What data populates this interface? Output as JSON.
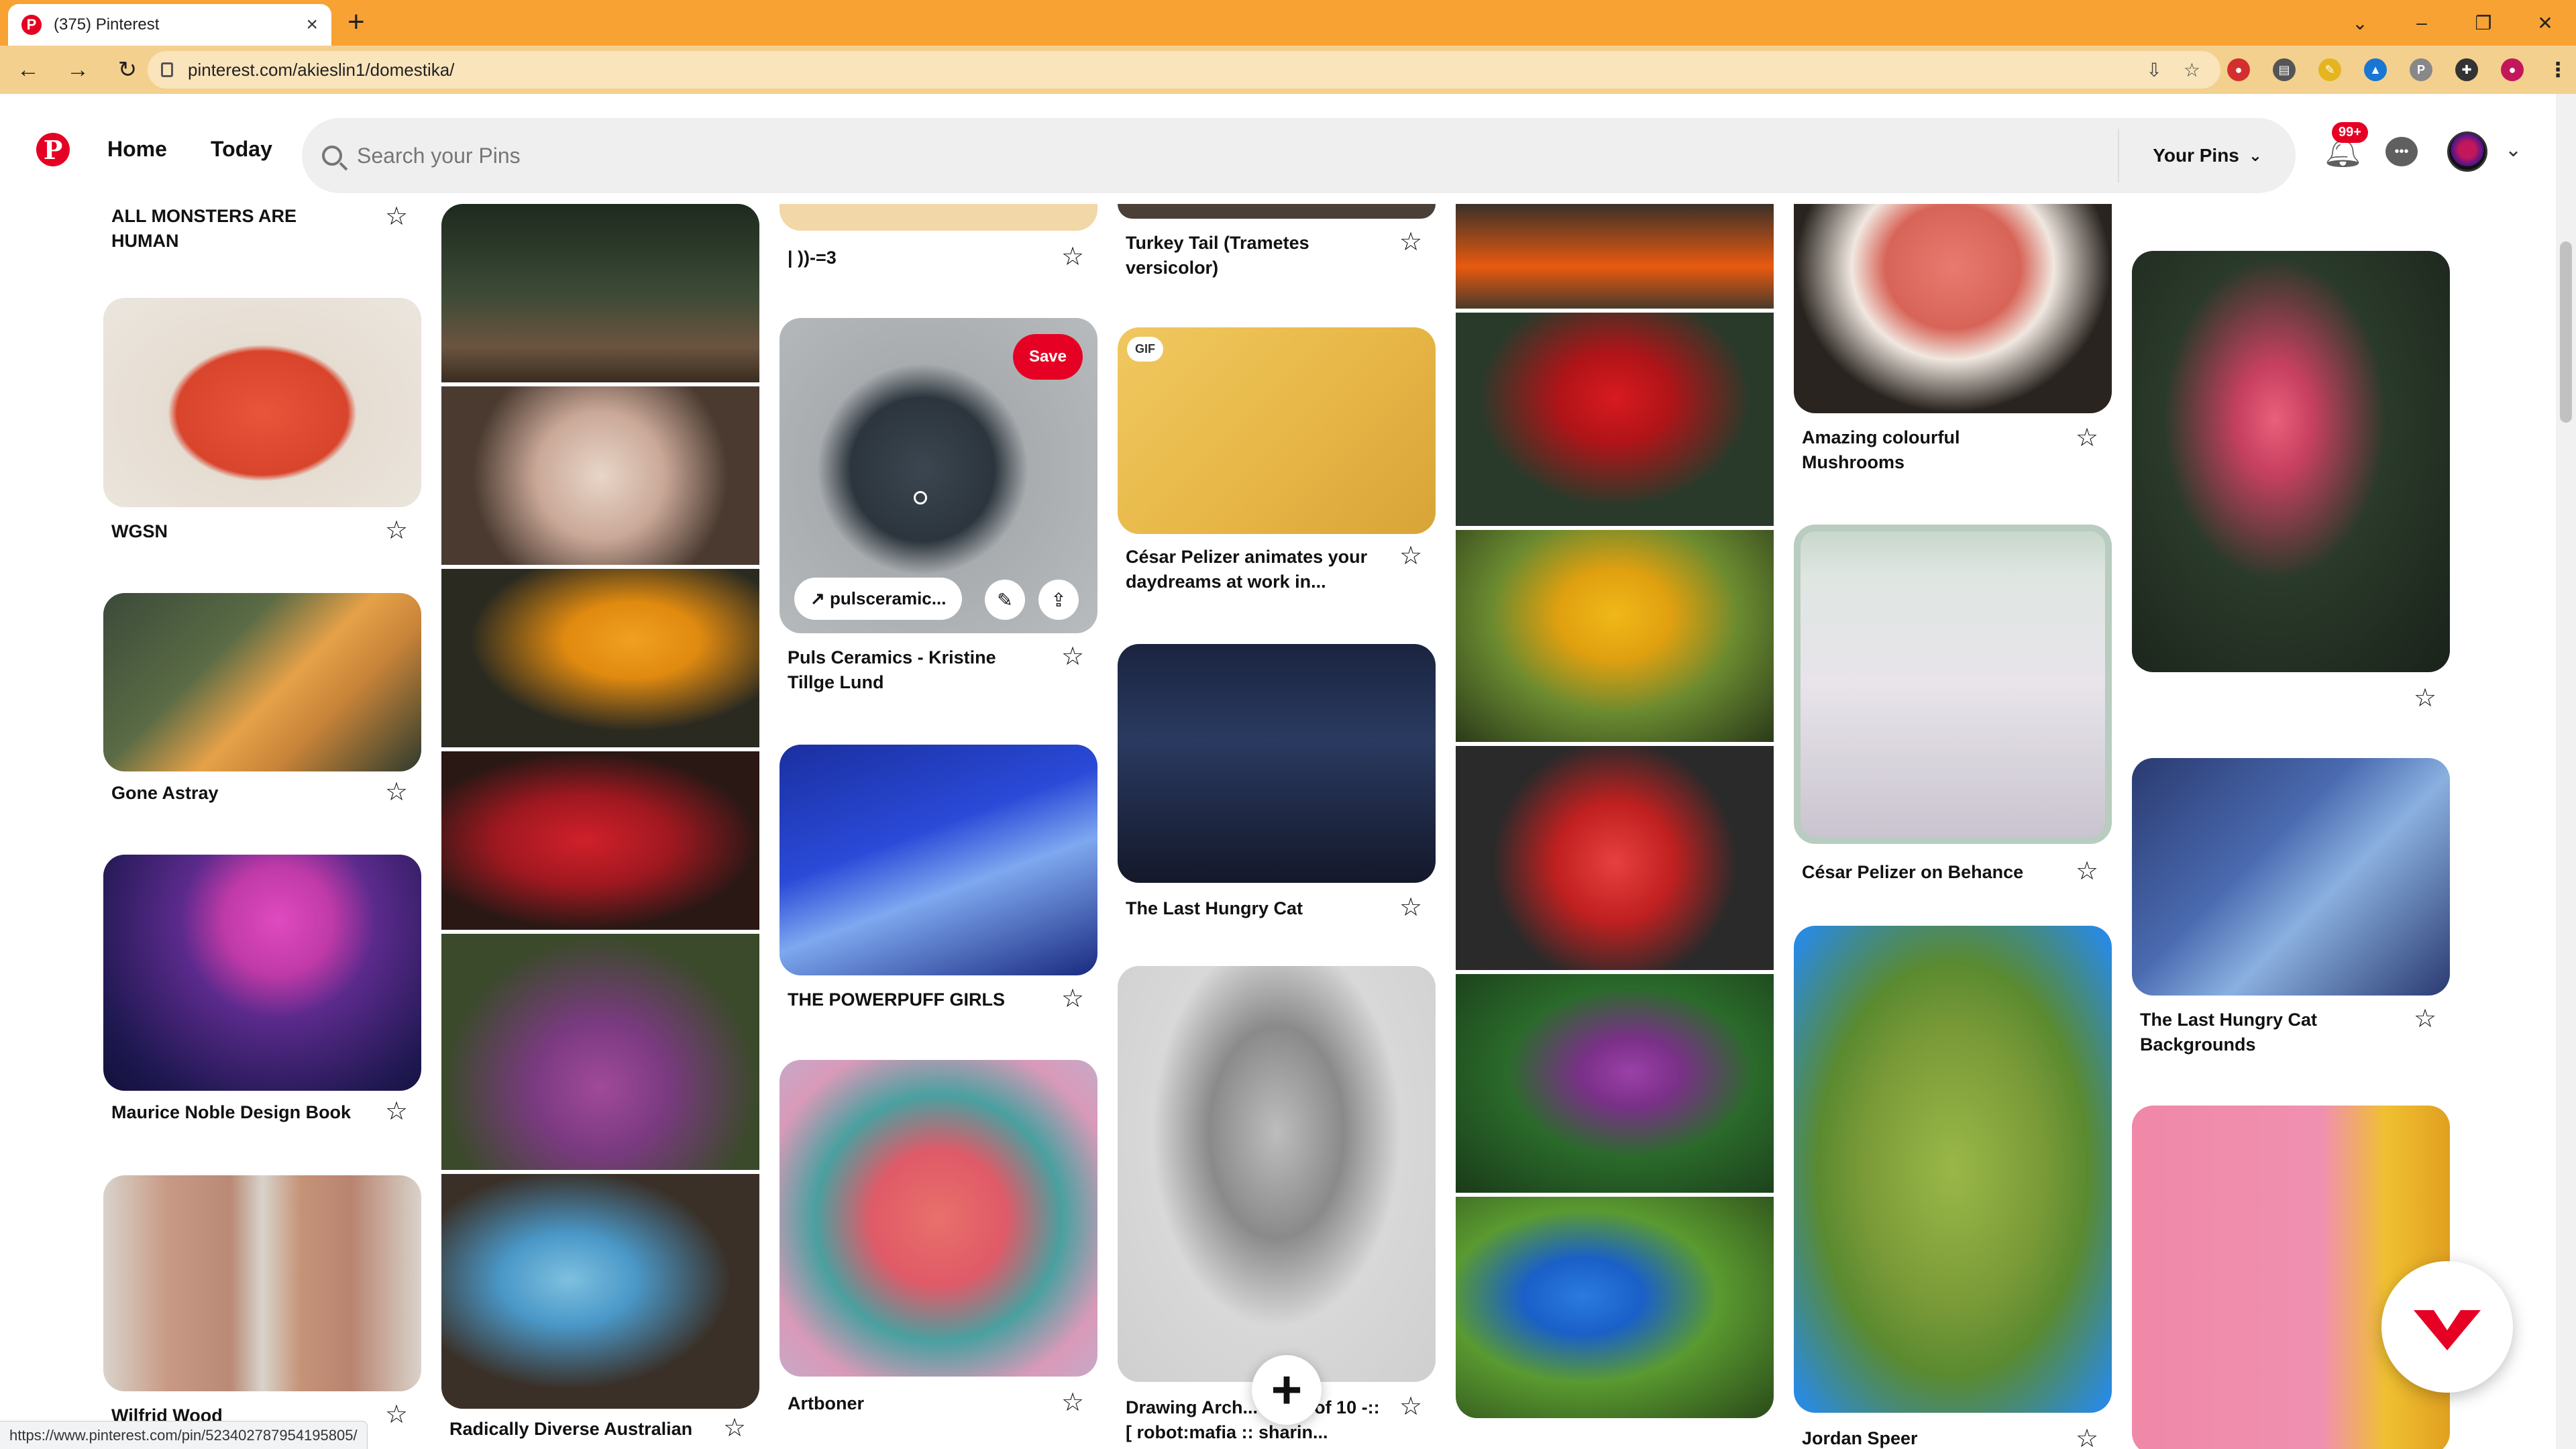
{
  "browser": {
    "tab_title": "(375) Pinterest",
    "tab_close": "×",
    "new_tab": "+",
    "url": "pinterest.com/akieslin1/domestika/",
    "status_url": "https://www.pinterest.com/pin/523402787954195805/"
  },
  "header": {
    "logo": "P",
    "nav": [
      "Home",
      "Today"
    ],
    "search_placeholder": "Search your Pins",
    "your_pins": "Your Pins",
    "notification_badge": "99+"
  },
  "pins": {
    "col1": [
      {
        "title": "ALL MONSTERS ARE HUMAN"
      },
      {
        "title": "WGSN"
      },
      {
        "title": "Gone Astray"
      },
      {
        "title": "Maurice Noble Design Book"
      },
      {
        "title": "Wilfrid Wood"
      }
    ],
    "col2": [
      {
        "title": "Radically Diverse Australian"
      }
    ],
    "col3": [
      {
        "title": "| ))-=3"
      },
      {
        "title": "Puls Ceramics - Kristine Tillge Lund",
        "save": "Save",
        "link": "pulsceramic..."
      },
      {
        "title": "THE POWERPUFF GIRLS"
      },
      {
        "title": "Artboner"
      }
    ],
    "col4": [
      {
        "title": "Turkey Tail (Trametes versicolor)"
      },
      {
        "title": "César Pelizer animates your daydreams at work in...",
        "badge": "GIF"
      },
      {
        "title": "The Last Hungry Cat"
      },
      {
        "title": "Drawing Arch... age 2 of 10 -::[ robot:mafia :: sharin..."
      }
    ],
    "col6": [
      {
        "title": "Amazing colourful Mushrooms"
      },
      {
        "title": "César Pelizer on Behance"
      },
      {
        "title": "Jordan Speer"
      }
    ],
    "col7": [
      {
        "title": "The Last Hungry Cat Backgrounds"
      }
    ]
  },
  "colors": {
    "brand": "#e60023",
    "tabstrip": "#f7a233",
    "toolbar": "#f4d08f"
  }
}
